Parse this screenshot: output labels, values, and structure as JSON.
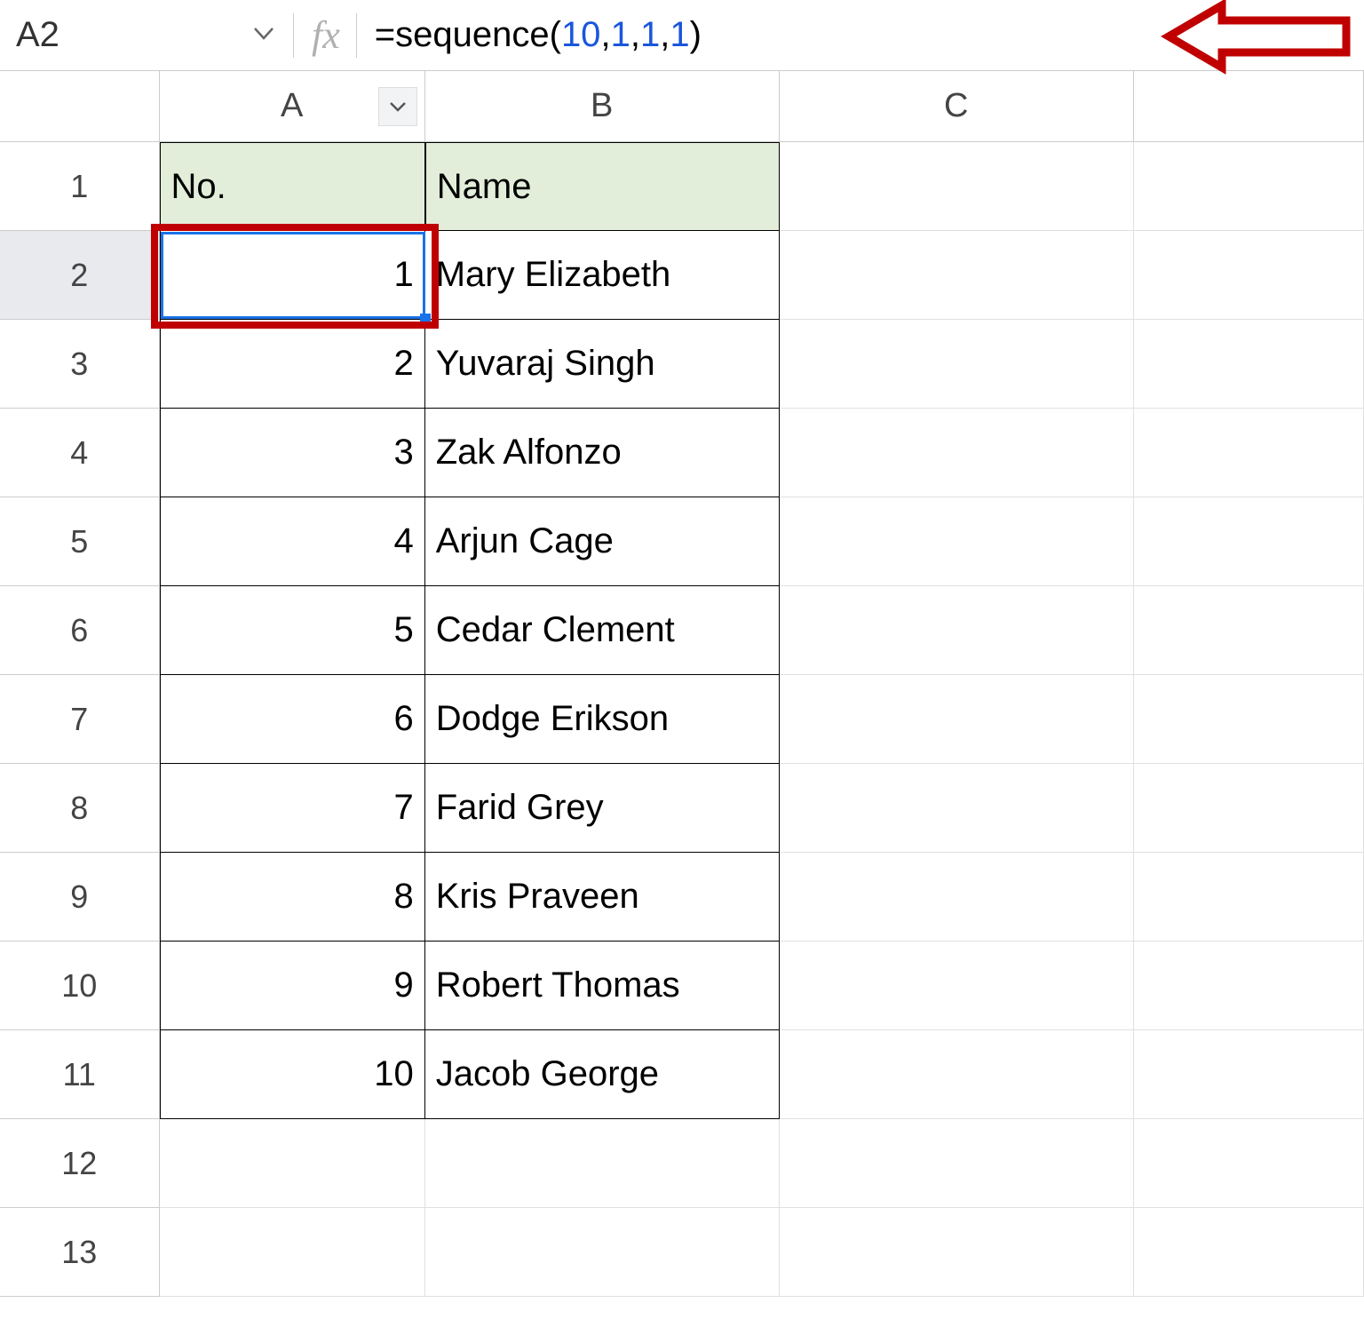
{
  "name_box": {
    "value": "A2"
  },
  "formula_bar": {
    "fx_label": "fx",
    "formula_text": "=sequence(10,1,1,1)",
    "formula_parts": {
      "eq": "=",
      "fn": "sequence",
      "open": "(",
      "n1": "10",
      "c1": ",",
      "n2": "1",
      "c2": ",",
      "n3": "1",
      "c3": ",",
      "n4": "1",
      "close": ")"
    }
  },
  "column_headers": [
    "A",
    "B",
    "C"
  ],
  "row_headers": [
    "1",
    "2",
    "3",
    "4",
    "5",
    "6",
    "7",
    "8",
    "9",
    "10",
    "11",
    "12",
    "13"
  ],
  "active_row": "2",
  "active_col": "A",
  "selected_cell": "A2",
  "table": {
    "headers": {
      "a": "No.",
      "b": "Name"
    },
    "rows": [
      {
        "a": "1",
        "b": "Mary Elizabeth"
      },
      {
        "a": "2",
        "b": "Yuvaraj Singh"
      },
      {
        "a": "3",
        "b": "Zak Alfonzo"
      },
      {
        "a": "4",
        "b": "Arjun Cage"
      },
      {
        "a": "5",
        "b": "Cedar Clement"
      },
      {
        "a": "6",
        "b": "Dodge Erikson"
      },
      {
        "a": "7",
        "b": "Farid Grey"
      },
      {
        "a": "8",
        "b": "Kris Praveen"
      },
      {
        "a": "9",
        "b": "Robert Thomas"
      },
      {
        "a": "10",
        "b": "Jacob George"
      }
    ]
  },
  "annotations": {
    "arrow_color": "#c00000",
    "highlight_cell": "A2"
  }
}
